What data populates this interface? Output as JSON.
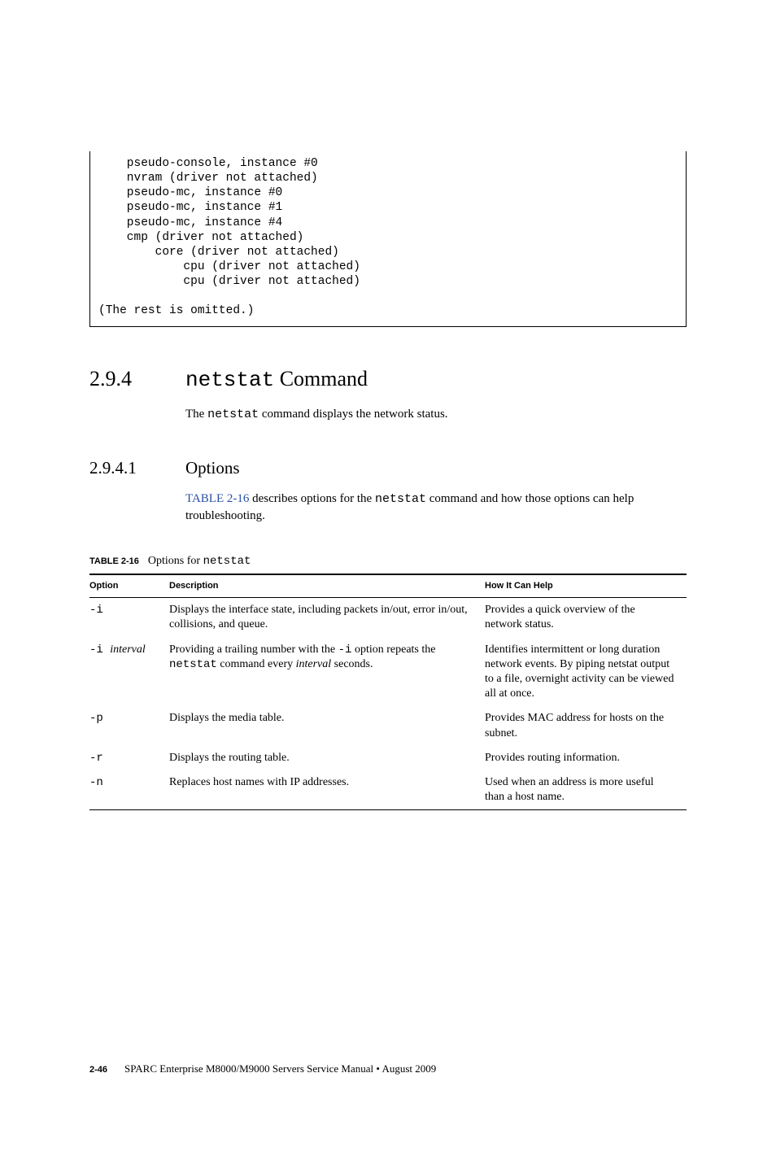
{
  "code": {
    "lines": [
      "    pseudo-console, instance #0",
      "    nvram (driver not attached)",
      "    pseudo-mc, instance #0",
      "    pseudo-mc, instance #1",
      "    pseudo-mc, instance #4",
      "    cmp (driver not attached)",
      "        core (driver not attached)",
      "            cpu (driver not attached)",
      "            cpu (driver not attached)",
      "",
      "(The rest is omitted.)"
    ]
  },
  "section": {
    "number": "2.9.4",
    "title_cmd": "netstat",
    "title_rest": " Command",
    "intro_pre": "The ",
    "intro_cmd": "netstat",
    "intro_post": " command displays the network status."
  },
  "subsection": {
    "number": "2.9.4.1",
    "title": "Options",
    "para_link": "TABLE 2-16",
    "para_mid1": " describes options for the ",
    "para_cmd": "netstat",
    "para_mid2": " command and how those options can help troubleshooting."
  },
  "table": {
    "label": "TABLE 2-16",
    "caption_pre": "Options for ",
    "caption_cmd": "netstat",
    "headers": {
      "c1": "Option",
      "c2": "Description",
      "c3": "How It Can Help"
    },
    "rows": [
      {
        "opt": "-i",
        "opt_ital": "",
        "desc_plain": "Displays the interface state, including packets in/out, error in/out, collisions, and queue.",
        "help": "Provides a quick overview of the network status."
      },
      {
        "opt": "-i ",
        "opt_ital": "interval",
        "desc_pre": "Providing a trailing number with the ",
        "desc_code": "-i",
        "desc_mid": " option repeats the ",
        "desc_code2": "netstat",
        "desc_mid2": " command every ",
        "desc_ital": "interval",
        "desc_post": " seconds.",
        "help": "Identifies intermittent or long duration network events. By piping netstat output to a file, overnight activity can be viewed all at once."
      },
      {
        "opt": "-p",
        "opt_ital": "",
        "desc_plain": "Displays the media table.",
        "help": "Provides MAC address for hosts on the subnet."
      },
      {
        "opt": "-r",
        "opt_ital": "",
        "desc_plain": "Displays the routing table.",
        "help": "Provides routing information."
      },
      {
        "opt": "-n",
        "opt_ital": "",
        "desc_plain": "Replaces host names with IP addresses.",
        "help": "Used when an address is more useful than a host name."
      }
    ]
  },
  "footer": {
    "pagenum": "2-46",
    "text": "SPARC Enterprise M8000/M9000 Servers Service Manual • August 2009"
  }
}
